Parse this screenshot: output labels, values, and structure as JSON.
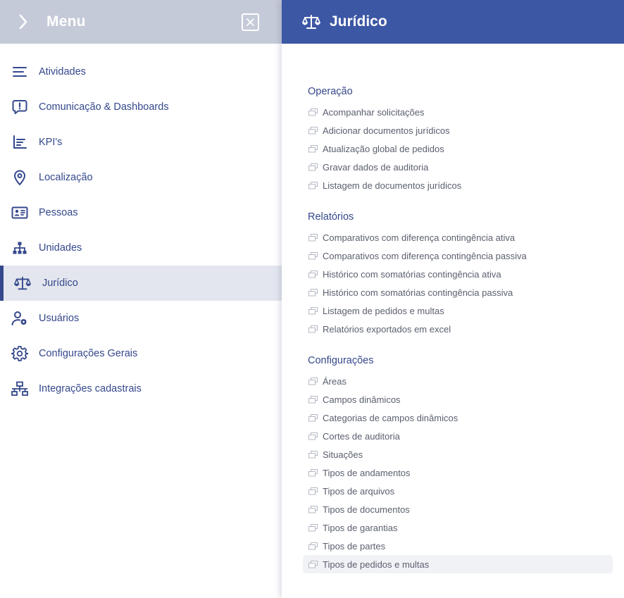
{
  "menu": {
    "title": "Menu",
    "items": [
      {
        "label": "Atividades"
      },
      {
        "label": "Comunicação & Dashboards"
      },
      {
        "label": "KPI's"
      },
      {
        "label": "Localização"
      },
      {
        "label": "Pessoas"
      },
      {
        "label": "Unidades"
      },
      {
        "label": "Jurídico"
      },
      {
        "label": "Usuários"
      },
      {
        "label": "Configurações Gerais"
      },
      {
        "label": "Integrações cadastrais"
      }
    ]
  },
  "panel": {
    "title": "Jurídico",
    "sections": [
      {
        "title": "Operação",
        "links": [
          "Acompanhar solicitações",
          "Adicionar documentos jurídicos",
          "Atualização global de pedidos",
          "Gravar dados de auditoria",
          "Listagem de documentos jurídicos"
        ]
      },
      {
        "title": "Relatórios",
        "links": [
          "Comparativos com diferença contingência ativa",
          "Comparativos com diferença contingência passiva",
          "Histórico com somatórias contingência ativa",
          "Histórico com somatórias contingência passiva",
          "Listagem de pedidos e multas",
          "Relatórios exportados em excel"
        ]
      },
      {
        "title": "Configurações",
        "links": [
          "Áreas",
          "Campos dinâmicos",
          "Categorias de campos dinâmicos",
          "Cortes de auditoria",
          "Situações",
          "Tipos de andamentos",
          "Tipos de arquivos",
          "Tipos de documentos",
          "Tipos de garantias",
          "Tipos de partes",
          "Tipos de pedidos e multas"
        ]
      }
    ]
  },
  "colors": {
    "menu_header_bg": "#c5cad8",
    "panel_header_bg": "#3c57a4",
    "accent": "#34488c",
    "active_item_bg": "#e3e6ee"
  }
}
